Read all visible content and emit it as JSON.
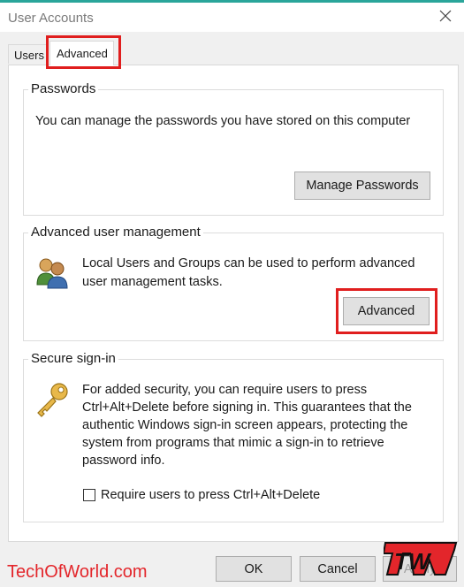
{
  "window": {
    "title": "User Accounts"
  },
  "tabs": [
    {
      "label": "Users",
      "selected": false
    },
    {
      "label": "Advanced",
      "selected": true
    }
  ],
  "passwords": {
    "group_label": "Passwords",
    "description": "You can manage the passwords you have stored on this computer",
    "button_label": "Manage Passwords"
  },
  "advanced_mgmt": {
    "group_label": "Advanced user management",
    "description_line1": "Local Users and Groups can be used to perform advanced",
    "description_line2": "user management tasks.",
    "button_label": "Advanced"
  },
  "secure_signin": {
    "group_label": "Secure sign-in",
    "lines": [
      "For added security, you can require users to press",
      "Ctrl+Alt+Delete before signing in. This guarantees that the",
      "authentic Windows sign-in screen appears, protecting the",
      "system from programs that mimic a sign-in to retrieve",
      "password info."
    ],
    "checkbox_label": "Require users to press Ctrl+Alt+Delete",
    "checkbox_checked": false
  },
  "footer": {
    "ok_label": "OK",
    "cancel_label": "Cancel",
    "apply_label": "Apply"
  },
  "watermark": {
    "site": "TechOfWorld.com",
    "logo_text": "TW"
  },
  "colors": {
    "highlight_box": "#e01e1e",
    "accent_line": "#2aa59a",
    "watermark_red": "#e3262b"
  },
  "icons": {
    "users_group": "users-group-icon",
    "key": "key-icon",
    "close": "close-icon"
  }
}
